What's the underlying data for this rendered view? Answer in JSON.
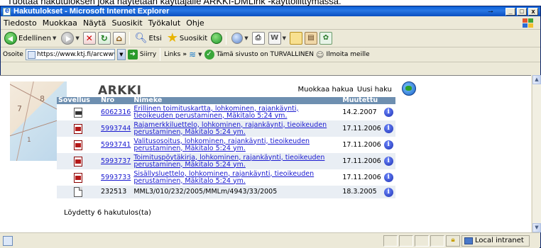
{
  "caption": "Tuottaa hakutuloksen joka näytetään käyttäjälle ARKKI-DMLink -käyttöliittymässä.",
  "window": {
    "title": "Hakutulokset - Microsoft Internet Explorer",
    "controls": {
      "arrow": "→",
      "minimize": "_",
      "maximize": "□",
      "close": "x"
    }
  },
  "menu": [
    "Tiedosto",
    "Muokkaa",
    "Näytä",
    "Suosikit",
    "Työkalut",
    "Ohje"
  ],
  "toolbar": {
    "back_label": "Edellinen",
    "search_label": "Etsi",
    "favorites_label": "Suosikit"
  },
  "addressbar": {
    "label": "Osoite",
    "url": "https://www.ktj.fi/arcwww",
    "go_label": "Siirry",
    "links_label": "Links",
    "security_text": "Tämä sivusto on TURVALLINEN",
    "notify_label": "Ilmoita meille"
  },
  "page": {
    "app_title": "ARKKI",
    "edit_search": "Muokkaa hakua",
    "new_search": "Uusi haku",
    "map_numbers": [
      "7",
      "8",
      "1"
    ],
    "headers": {
      "sovellus": "Sovellus",
      "nro": "Nro",
      "nimeke": "Nimeke",
      "muutettu": "Muutettu"
    },
    "rows": [
      {
        "icon": "jpg-document-icon",
        "nro": "6062316",
        "nimeke": "Erillinen toimituskartta, lohkominen, rajankäynti, tieoikeuden perustaminen, Mäkitalo 5:24 ym.",
        "muutettu": "14.2.2007"
      },
      {
        "icon": "pdf-document-icon",
        "nro": "5993744",
        "nimeke": "Rajamerkkiluettelo, lohkominen, rajankäynti, tieoikeuden perustaminen, Mäkitalo 5:24 ym.",
        "muutettu": "17.11.2006"
      },
      {
        "icon": "pdf-document-icon",
        "nro": "5993741",
        "nimeke": "Valitusosoitus, lohkominen, rajankäynti, tieoikeuden perustaminen, Mäkitalo 5:24 ym.",
        "muutettu": "17.11.2006"
      },
      {
        "icon": "pdf-document-icon",
        "nro": "5993737",
        "nimeke": "Toimituspöytäkirja, lohkominen, rajankäynti, tieoikeuden perustaminen, Mäkitalo 5:24 ym.",
        "muutettu": "17.11.2006"
      },
      {
        "icon": "pdf-document-icon",
        "nro": "5993733",
        "nimeke": "Sisällysluettelo, lohkominen, rajankäynti, tieoikeuden perustaminen, Mäkitalo 5:24 ym.",
        "muutettu": "17.11.2006"
      },
      {
        "icon": "plain-document-icon",
        "nro": "232513",
        "nimeke": "MML3/010/232/2005/MMLm/4943/33/2005",
        "muutettu": "18.3.2005"
      }
    ],
    "info_glyph": "i",
    "found_text": "Löydetty 6 hakutulos(ta)"
  },
  "statusbar": {
    "zone_text": "Local intranet"
  }
}
